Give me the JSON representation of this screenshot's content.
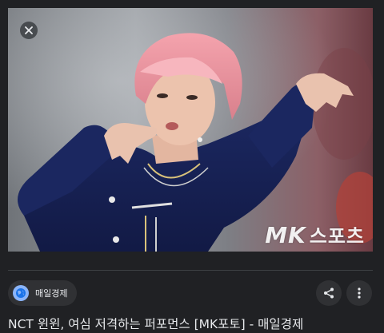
{
  "image": {
    "watermark_brand": "MK",
    "watermark_section": "스포츠"
  },
  "source": {
    "name": "매일경제"
  },
  "article": {
    "title": "NCT 윈윈, 여심 저격하는 퍼포먼스 [MK포토] - 매일경제"
  },
  "icons": {
    "close": "close-icon",
    "globe": "globe-icon",
    "share": "share-icon",
    "more": "more-vert-icon"
  },
  "colors": {
    "background": "#202124",
    "chip": "#303134",
    "text": "#e8eaed",
    "accent": "#8ab4f8"
  }
}
